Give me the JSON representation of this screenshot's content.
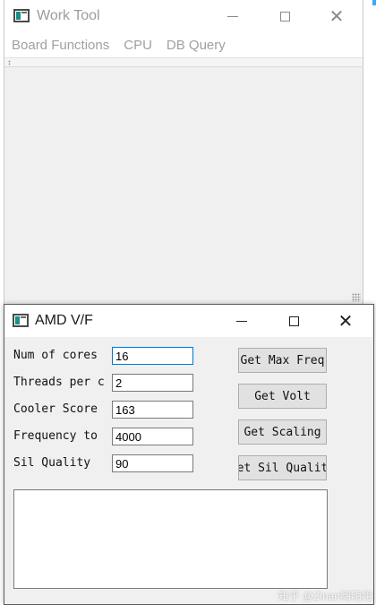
{
  "main_window": {
    "title": "Work Tool",
    "menu": [
      "Board Functions",
      "CPU",
      "DB Query"
    ],
    "controls": {
      "minimize_icon": "minimize-icon",
      "maximize_icon": "maximize-icon",
      "close_icon": "close-icon",
      "close_glyph": "✕"
    }
  },
  "dialog": {
    "title": "AMD V/F",
    "close_glyph": "✕",
    "fields": [
      {
        "label": "Num of cores",
        "value": "16"
      },
      {
        "label": "Threads per c",
        "value": "2"
      },
      {
        "label": "Cooler Score",
        "value": "163"
      },
      {
        "label": "Frequency to",
        "value": "4000"
      },
      {
        "label": "Sil Quality",
        "value": "90"
      }
    ],
    "buttons": [
      "Get Max Freq",
      "Get Volt",
      "Get Scaling",
      "Get Sil Quality"
    ],
    "output_text": ""
  },
  "watermark": "知乎 @Zinan嗨嗨嗨"
}
